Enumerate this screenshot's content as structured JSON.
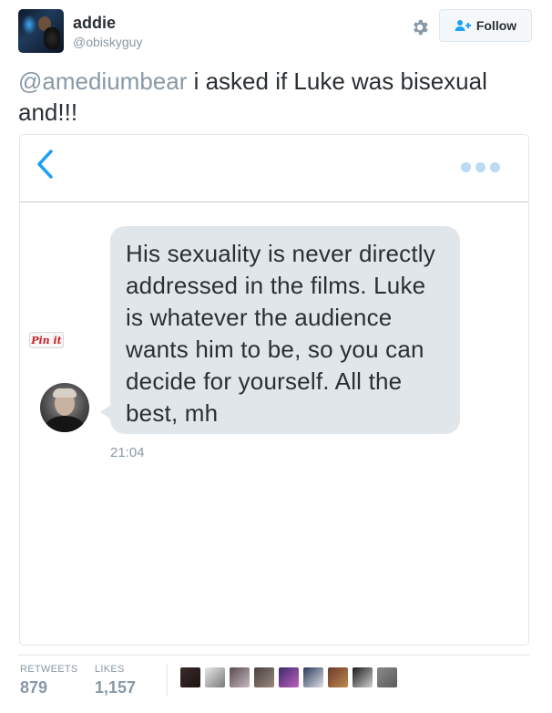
{
  "tweet": {
    "display_name": "addie",
    "screen_name": "@obiskyguy",
    "follow_label": "Follow",
    "mention": "@amediumbear",
    "text_line1": " i asked if Luke was bisexual",
    "text_line2": "and!!!"
  },
  "screenshot": {
    "message": "His sexuality is never directly addressed in the films. Luke is whatever the audience wants him to be, so you can decide for yourself. All the best, mh",
    "time": "21:04",
    "pin_label": "Pin it"
  },
  "stats": {
    "retweets_label": "RETWEETS",
    "retweets_value": "879",
    "likes_label": "LIKES",
    "likes_value": "1,157"
  },
  "colors": {
    "accent_blue": "#1da1f2",
    "muted_gray": "#8899a6",
    "bubble_gray": "#e1e6eb"
  },
  "icons": {
    "settings": "gear-icon",
    "follow": "add-user-icon",
    "back": "chevron-left-icon",
    "more": "more-dots-icon"
  }
}
